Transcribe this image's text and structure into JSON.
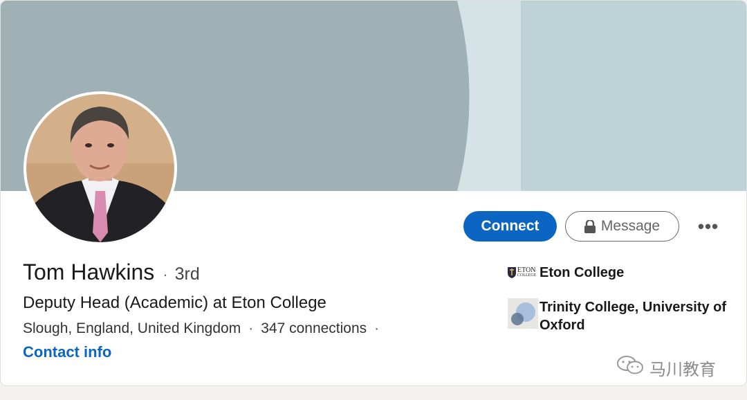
{
  "profile": {
    "name": "Tom Hawkins",
    "separator": "·",
    "degree": "3rd",
    "headline": "Deputy Head (Academic) at Eton College",
    "location": "Slough, England, United Kingdom",
    "loc_sep": "·",
    "connections": "347 connections",
    "trail_sep": "·",
    "contact_info": "Contact info"
  },
  "actions": {
    "connect_label": "Connect",
    "message_label": "Message",
    "more_label": "•••"
  },
  "organizations": [
    {
      "name": "Eton College",
      "logo_text_top": "ETON",
      "logo_text_bottom": "COLLEGE",
      "logo": "eton-crest-logo"
    },
    {
      "name_line1": "Trinity College, University of",
      "name_line2": "Oxford",
      "logo": "trinity-circles-logo"
    }
  ],
  "watermark": {
    "text": "马川教育",
    "icon": "wechat-icon"
  },
  "colors": {
    "banner_dark": "#9fb1b5",
    "banner_light": "#bed3d7",
    "banner_gap": "#d5e3e6",
    "accent": "#0a66c2"
  }
}
